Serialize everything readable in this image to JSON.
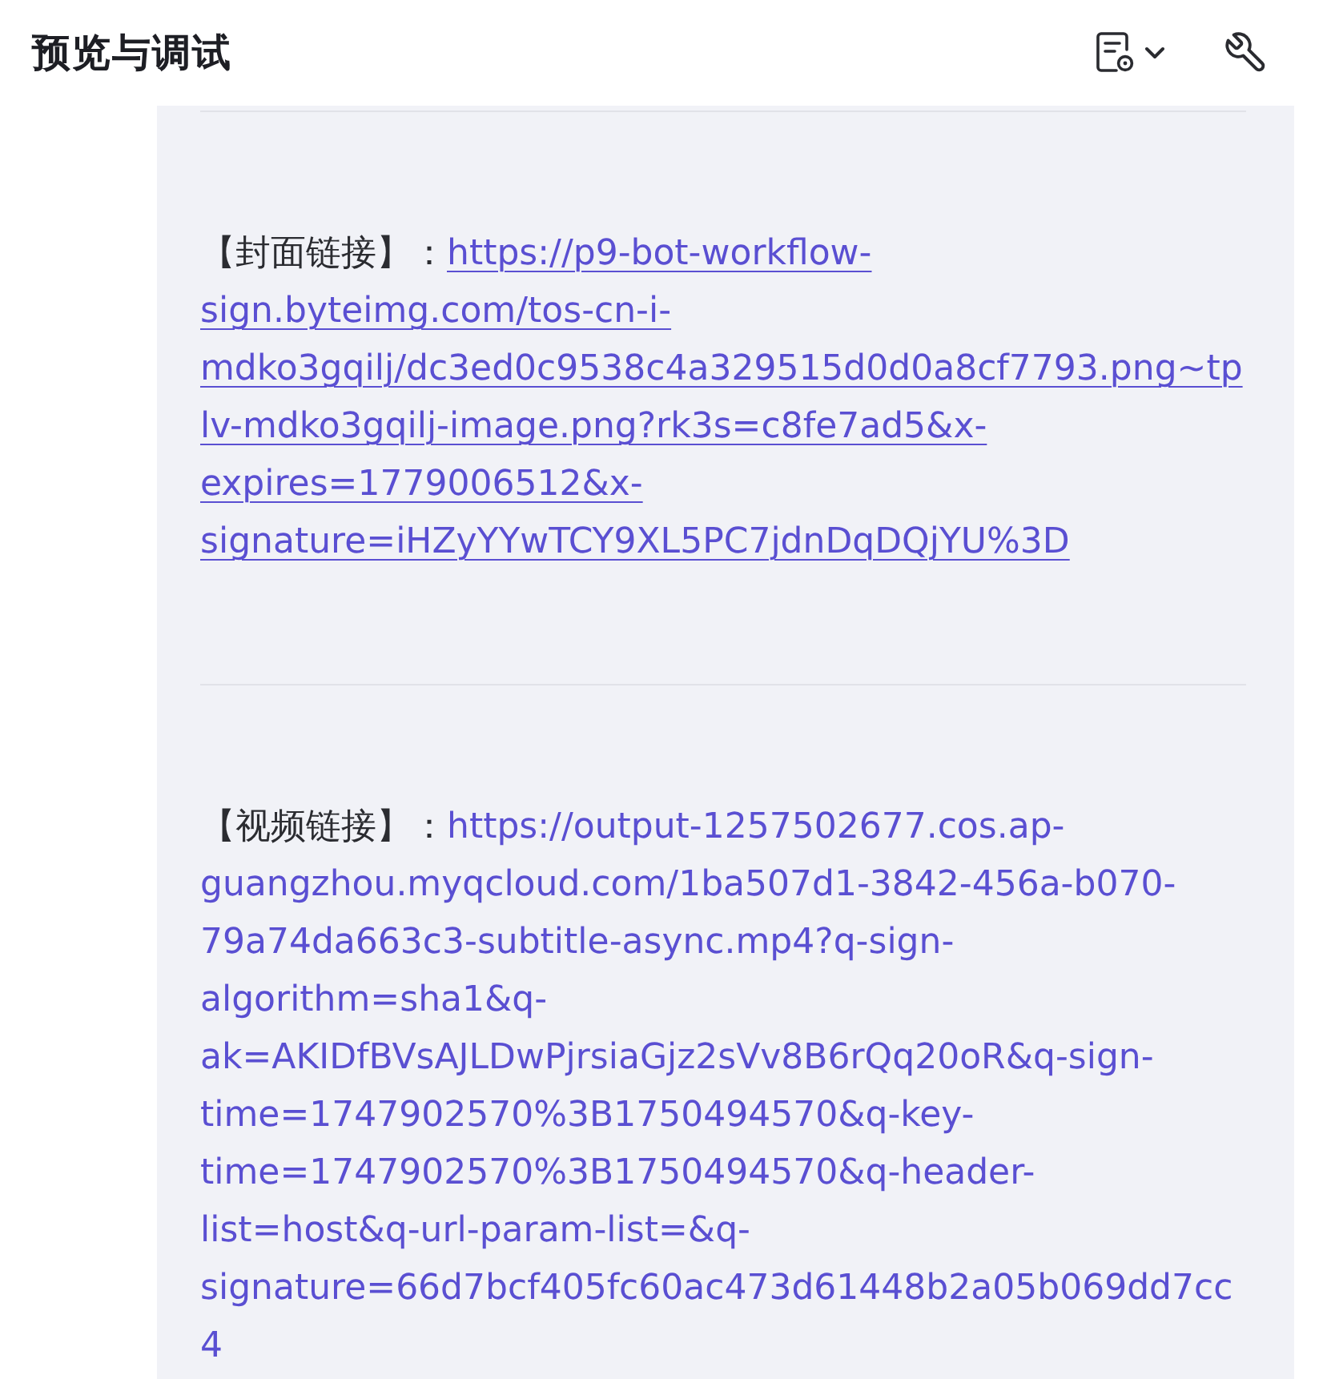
{
  "header": {
    "title": "预览与调试"
  },
  "entries": [
    {
      "label": "【封面链接】：",
      "link": "https://p9-bot-workflow-sign.byteimg.com/tos-cn-i-mdko3gqilj/dc3ed0c9538c4a329515d0d0a8cf7793.png~tplv-mdko3gqilj-image.png?rk3s=c8fe7ad5&x-expires=1779006512&x-signature=iHZyYYwTCY9XL5PC7jdnDqDQjYU%3D",
      "underlined": true
    },
    {
      "label": "【视频链接】：",
      "link": "https://output-1257502677.cos.ap-guangzhou.myqcloud.com/1ba507d1-3842-456a-b070-79a74da663c3-subtitle-async.mp4?q-sign-algorithm=sha1&q-ak=AKIDfBVsAJLDwPjrsiaGjz2sVv8B6rQq20oR&q-sign-time=1747902570%3B1750494570&q-key-time=1747902570%3B1750494570&q-header-list=host&q-url-param-list=&q-signature=66d7bcf405fc60ac473d61448b2a05b069dd7cc4",
      "underlined": false
    }
  ]
}
